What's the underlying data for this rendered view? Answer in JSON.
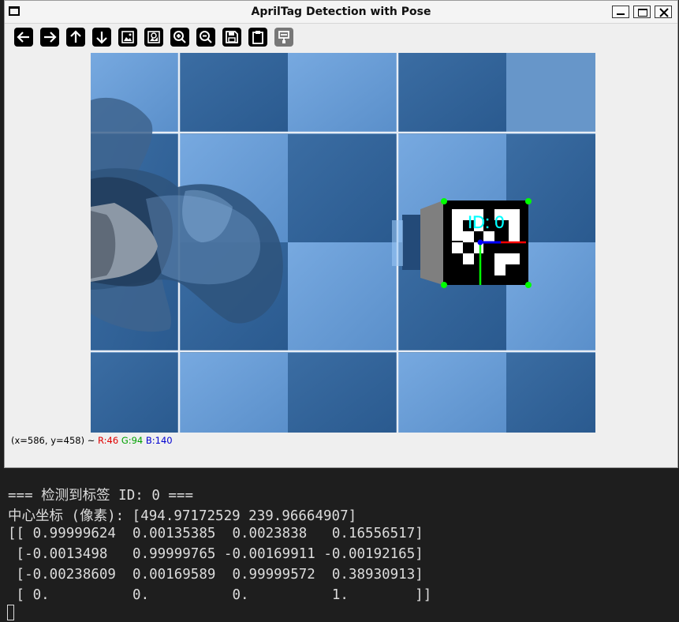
{
  "window": {
    "title": "AprilTag Detection with Pose",
    "controls": [
      "minimize-icon",
      "maximize-icon",
      "close-icon"
    ]
  },
  "toolbar": {
    "buttons": [
      {
        "icon": "arrow-left-icon"
      },
      {
        "icon": "arrow-right-icon"
      },
      {
        "icon": "arrow-up-icon"
      },
      {
        "icon": "arrow-down-icon"
      },
      {
        "icon": "image-icon"
      },
      {
        "icon": "zoom-region-icon"
      },
      {
        "icon": "zoom-in-icon"
      },
      {
        "icon": "zoom-out-icon"
      },
      {
        "icon": "save-icon"
      },
      {
        "icon": "clipboard-icon"
      },
      {
        "icon": "properties-icon"
      }
    ]
  },
  "viewport": {
    "tag_label": "ID: 0",
    "colors": {
      "axis_x": "#ff0000",
      "axis_y": "#00ff00",
      "axis_z": "#0000ff",
      "corner": "#00ff00",
      "label": "#00ffff",
      "tile_light": "#5f95cf",
      "tile_dark": "#2f5f95"
    }
  },
  "status": {
    "coords": "(x=586, y=458) ~",
    "r": "R:46",
    "g": "G:94",
    "b": "B:140"
  },
  "terminal": {
    "lines": [
      "=== 检测到标签 ID: 0 ===",
      "中心坐标 (像素): [494.97172529 239.96664907]",
      "[[ 0.99999624  0.00135385  0.0023838   0.16556517]",
      " [-0.0013498   0.99999765 -0.00169911 -0.00192165]",
      " [-0.00238609  0.00169589  0.99999572  0.38930913]",
      " [ 0.          0.          0.          1.        ]]"
    ]
  }
}
